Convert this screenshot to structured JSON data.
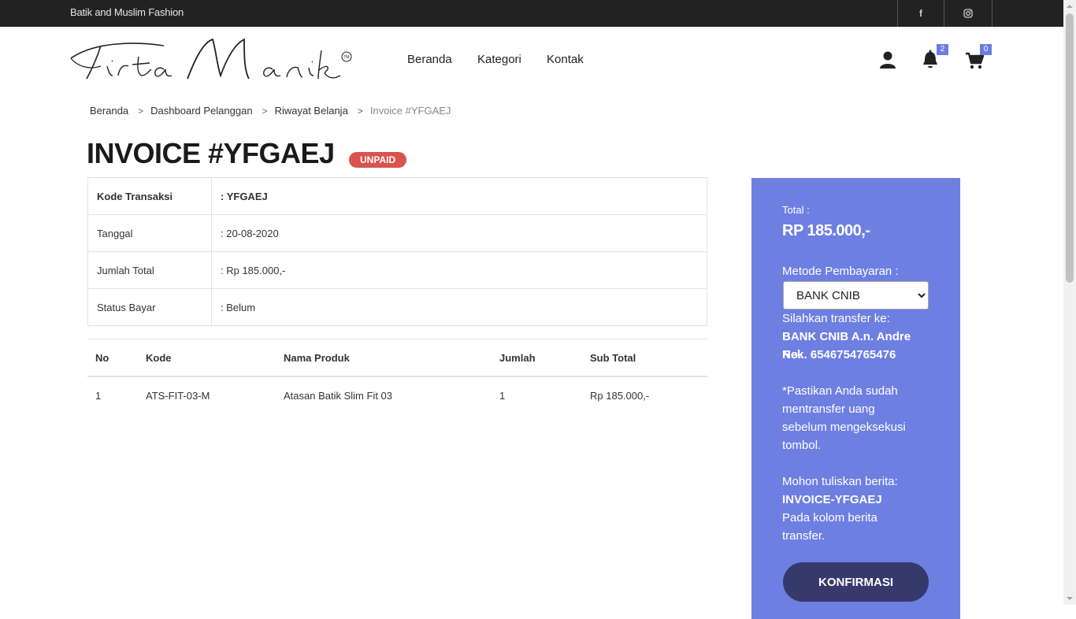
{
  "topbar": {
    "tagline": "Batik and Muslim Fashion",
    "social": [
      {
        "icon": "facebook-icon",
        "glyph": "f"
      },
      {
        "icon": "instagram-icon",
        "glyph": "◎"
      }
    ]
  },
  "brand": {
    "logo_text": "Tirta Manik",
    "trademark": "TM"
  },
  "nav": [
    "Beranda",
    "Kategori",
    "Kontak"
  ],
  "header_icons": {
    "user": "user-icon",
    "notifications": {
      "icon": "bell-icon",
      "count": "2"
    },
    "cart": {
      "icon": "cart-icon",
      "count": "0"
    }
  },
  "breadcrumb": [
    "Beranda",
    "Dashboard Pelanggan",
    "Riwayat Belanja",
    "Invoice #YFGAEJ"
  ],
  "invoice": {
    "title": "INVOICE #YFGAEJ",
    "status_badge": "UNPAID",
    "details": [
      {
        "label": "Kode Transaksi",
        "value": ": YFGAEJ"
      },
      {
        "label": "Tanggal",
        "value": ": 20-08-2020"
      },
      {
        "label": "Jumlah Total",
        "value": ": Rp 185.000,-"
      },
      {
        "label": "Status Bayar",
        "value": ": Belum"
      }
    ]
  },
  "products": {
    "headers": [
      "No",
      "Kode",
      "Nama Produk",
      "Jumlah",
      "Sub Total"
    ],
    "rows": [
      [
        "1",
        "ATS-FIT-03-M",
        "Atasan Batik Slim Fit 03",
        "1",
        "Rp 185.000,-"
      ]
    ]
  },
  "payment": {
    "total_label": "Total :",
    "total_value": "RP 185.000,-",
    "method_label": "Metode Pembayaran :",
    "method_selected": "BANK CNIB",
    "transfer_label": "Silahkan transfer ke:",
    "transfer_line1": "BANK CNIB A.n. Andre No.",
    "transfer_line2": "Rek. 6546754765476",
    "note": "*Pastikan Anda sudah mentransfer uang sebelum mengeksekusi tombol.",
    "message_label": "Mohon tuliskan berita:",
    "message_code": "INVOICE-YFGAEJ",
    "message_note": "Pada kolom berita transfer.",
    "confirm_label": "KONFIRMASI"
  },
  "colors": {
    "topbar": "#222222",
    "panel": "#6e7fe2",
    "confirm_button": "#363a6b",
    "unpaid_badge": "#d9534f",
    "count_badge": "#6b7de0"
  }
}
